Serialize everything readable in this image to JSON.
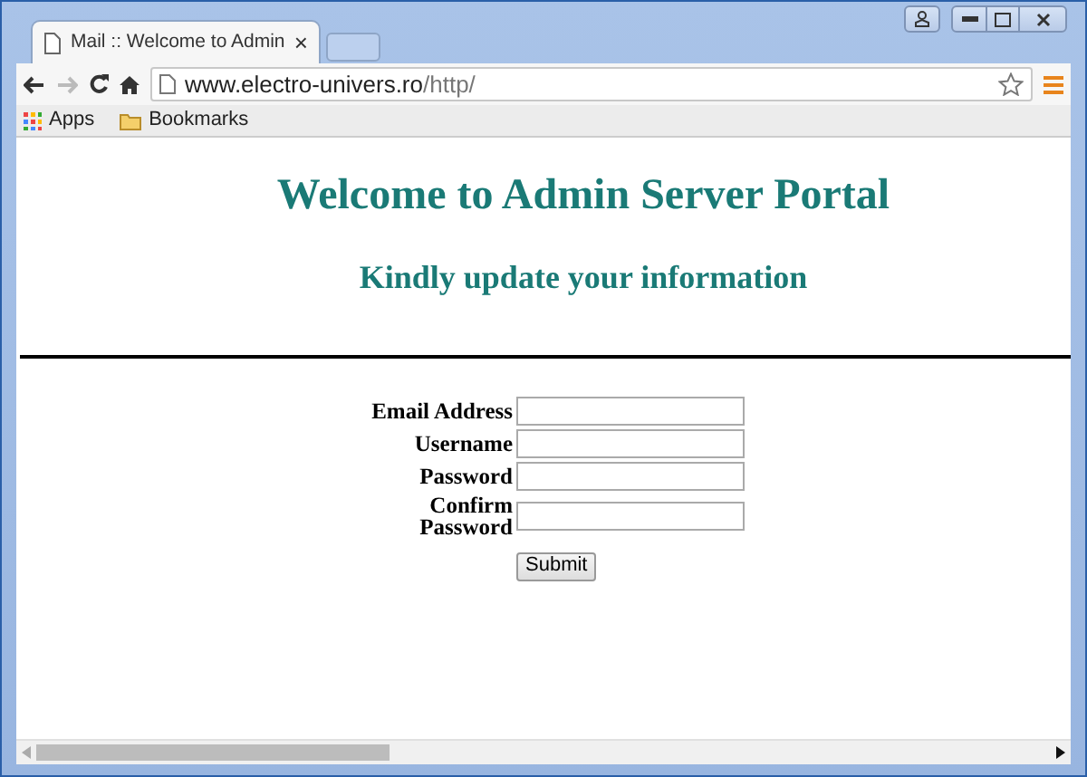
{
  "window": {
    "tab_title": "Mail :: Welcome to Admin",
    "tab_close": "×"
  },
  "address_bar": {
    "host": "www.electro-univers.ro",
    "path": "/http/"
  },
  "bookmarks": [
    "Apps",
    "Bookmarks"
  ],
  "page": {
    "title": "Welcome to Admin Server Portal",
    "subtitle": "Kindly update your information",
    "fields": [
      {
        "label": "Email Address"
      },
      {
        "label": "Username"
      },
      {
        "label": "Password"
      },
      {
        "label": "Confirm Password"
      }
    ],
    "submit": "Submit"
  }
}
